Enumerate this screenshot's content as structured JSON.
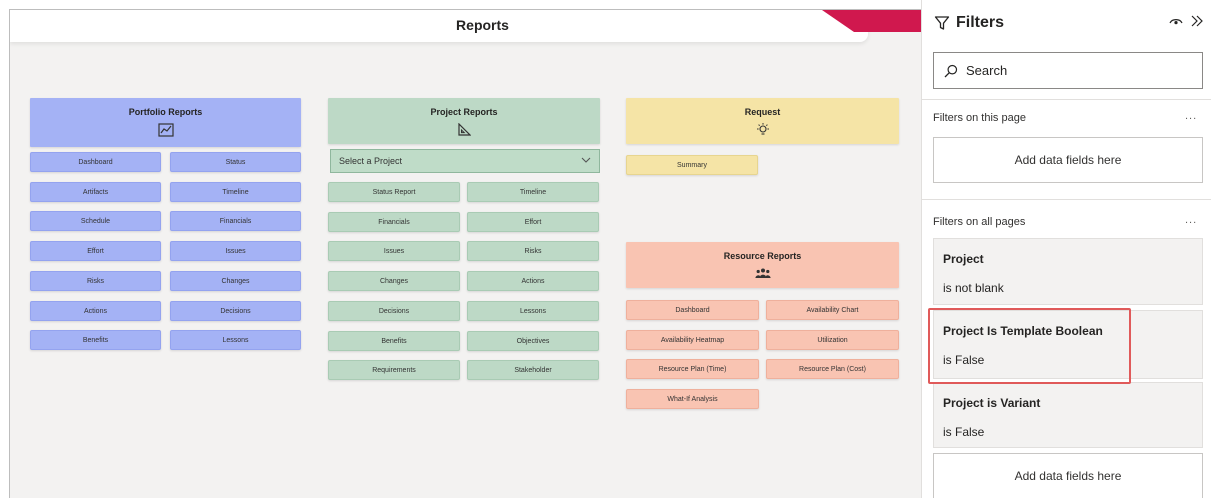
{
  "report": {
    "title": "Reports",
    "accent_color": "#d0184e",
    "portfolio": {
      "title": "Portfolio Reports",
      "icon": "chart-icon",
      "color": "#a4b2f5",
      "items": [
        "Dashboard",
        "Status",
        "Artifacts",
        "Timeline",
        "Schedule",
        "Financials",
        "Effort",
        "Issues",
        "Risks",
        "Changes",
        "Actions",
        "Decisions",
        "Benefits",
        "Lessons"
      ]
    },
    "project": {
      "title": "Project Reports",
      "icon": "triangle-ruler-icon",
      "color": "#bdd9c6",
      "select_value": "Select a Project",
      "items": [
        "Status Report",
        "Timeline",
        "Financials",
        "Effort",
        "Issues",
        "Risks",
        "Changes",
        "Actions",
        "Decisions",
        "Lessons",
        "Benefits",
        "Objectives",
        "Requirements",
        "Stakeholder"
      ]
    },
    "request": {
      "title": "Request",
      "icon": "lightbulb-icon",
      "color": "#f5e4a6",
      "items": [
        "Summary"
      ]
    },
    "resource": {
      "title": "Resource Reports",
      "icon": "people-icon",
      "color": "#f9c4b2",
      "items": [
        "Dashboard",
        "Availability Chart",
        "Availability Heatmap",
        "Utilization",
        "Resource Plan (Time)",
        "Resource Plan (Cost)",
        "What-If Analysis"
      ]
    }
  },
  "filters": {
    "title": "Filters",
    "search_label": "Search",
    "this_page_label": "Filters on this page",
    "all_pages_label": "Filters on all pages",
    "more_label": "...",
    "add_label": "Add data fields here",
    "cards": [
      {
        "name": "Project",
        "condition": "is not blank"
      },
      {
        "name": "Project Is Template Boolean",
        "condition": "is False"
      },
      {
        "name": "Project is Variant",
        "condition": "is False"
      }
    ],
    "highlight_color": "#e05a5a"
  }
}
